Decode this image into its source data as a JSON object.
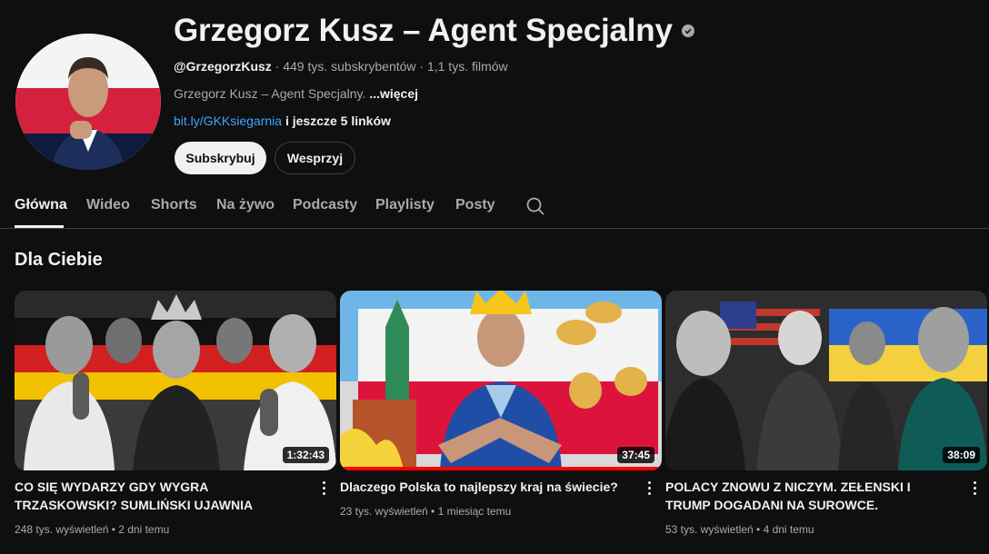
{
  "channel": {
    "name": "Grzegorz Kusz – Agent Specjalny",
    "handle": "@GrzegorzKusz",
    "stats": " · 449 tys. subskrybentów · 1,1 tys. filmów",
    "description": "Grzegorz Kusz – Agent Specjalny.",
    "more_label": "...więcej",
    "link_text": "bit.ly/GKKsiegarnia",
    "more_links": " i jeszcze 5 linków",
    "subscribe_label": "Subskrybuj",
    "support_label": "Wesprzyj"
  },
  "tabs": [
    {
      "label": "Główna",
      "active": true
    },
    {
      "label": "Wideo"
    },
    {
      "label": "Shorts"
    },
    {
      "label": "Na żywo"
    },
    {
      "label": "Podcasty"
    },
    {
      "label": "Playlisty"
    },
    {
      "label": "Posty"
    }
  ],
  "search_icon": "search-icon",
  "section": {
    "title": "Dla Ciebie"
  },
  "videos": [
    {
      "title": "CO SIĘ WYDARZY GDY WYGRA TRZASKOWSKI? SUMLIŃSKI UJAWNIA",
      "duration": "1:32:43",
      "meta": "248 tys. wyświetleń • 2 dni temu"
    },
    {
      "title": "Dlaczego Polska to najlepszy kraj na świecie?",
      "duration": "37:45",
      "meta": "23 tys. wyświetleń • 1 miesiąc temu",
      "watch_progress": 1.0
    },
    {
      "title": "POLACY ZNOWU Z NICZYM. ZEŁENSKI I TRUMP DOGADANI NA SUROWCE.",
      "duration": "38:09",
      "meta": "53 tys. wyświetleń • 4 dni temu"
    }
  ],
  "colors": {
    "background": "#0f0f0f",
    "link": "#3ea6ff",
    "progress": "#ff0000",
    "text_primary": "#f1f1f1",
    "text_secondary": "#aaaaaa"
  }
}
